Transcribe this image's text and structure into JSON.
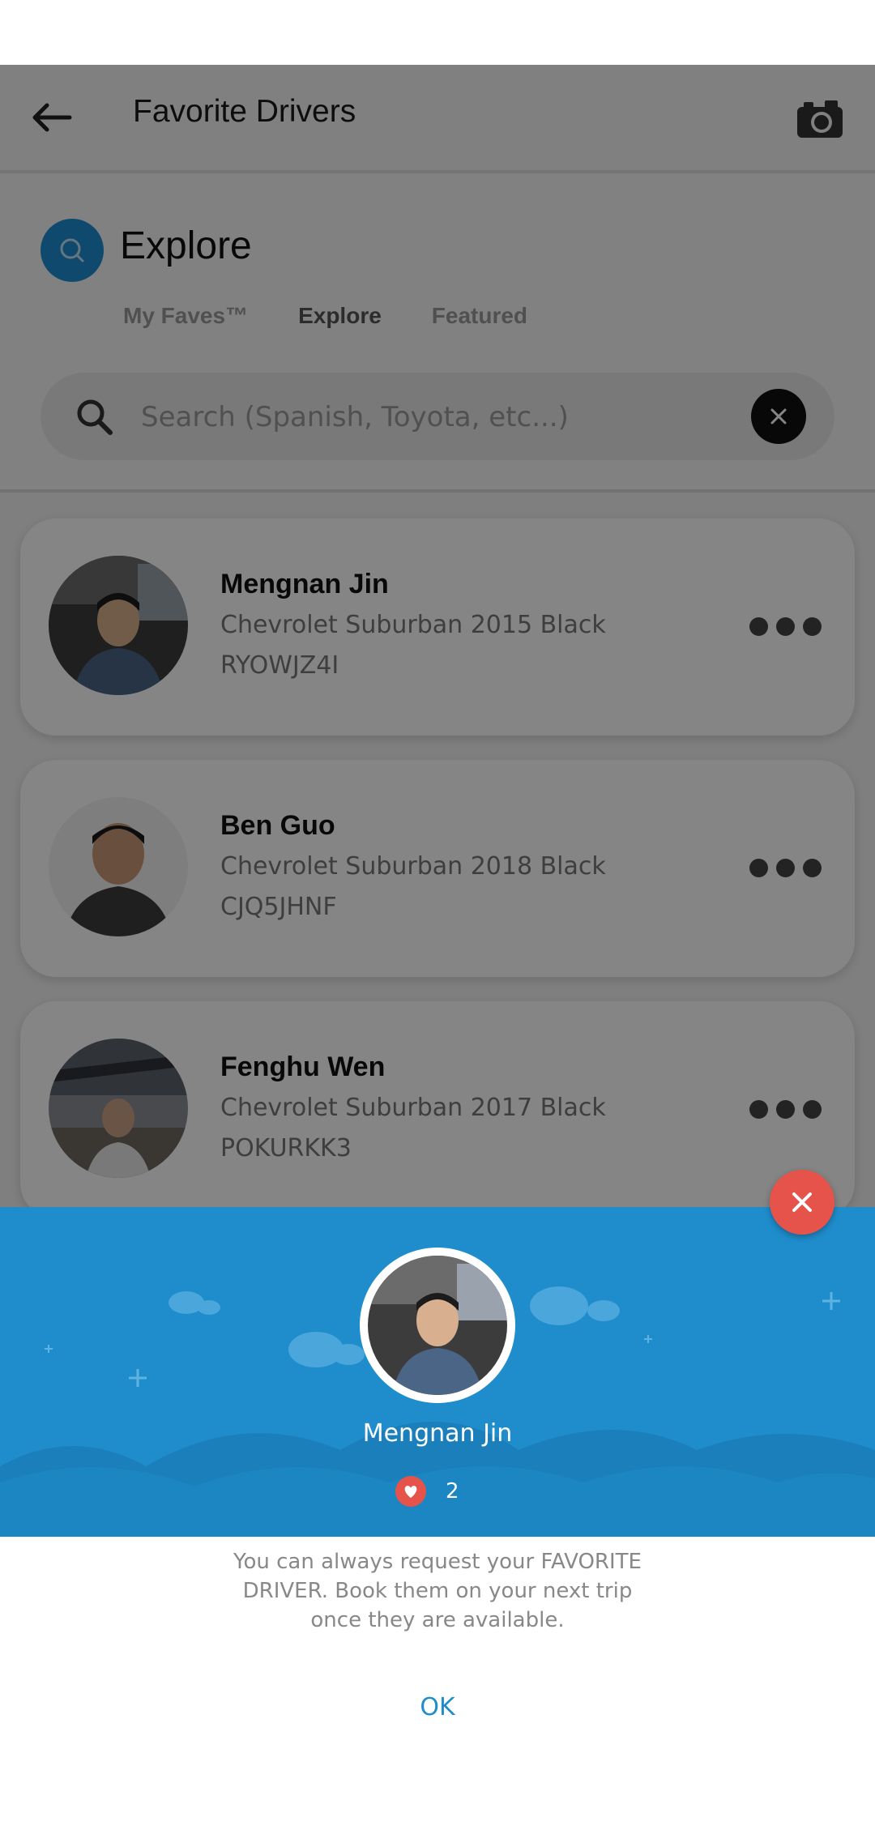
{
  "appbar": {
    "title": "Favorite Drivers"
  },
  "explore": {
    "title": "Explore",
    "tabs": [
      {
        "label": "My Faves™",
        "active": false
      },
      {
        "label": "Explore",
        "active": true
      },
      {
        "label": "Featured",
        "active": false
      }
    ],
    "search": {
      "placeholder": "Search (Spanish, Toyota, etc...)"
    }
  },
  "drivers": [
    {
      "name": "Mengnan Jin",
      "car": "Chevrolet Suburban 2015 Black",
      "plate": "RYOWJZ4I"
    },
    {
      "name": "Ben Guo",
      "car": "Chevrolet Suburban 2018 Black",
      "plate": "CJQ5JHNF"
    },
    {
      "name": "Fenghu Wen",
      "car": "Chevrolet Suburban 2017 Black",
      "plate": "POKURKK3"
    }
  ],
  "modal": {
    "name": "Mengnan Jin",
    "fav_count": "2",
    "message": "You can always request your FAVORITE DRIVER. Book them on your next trip once they are available.",
    "ok_label": "OK"
  },
  "colors": {
    "accent": "#1f8dcc",
    "danger": "#e6534b"
  },
  "icons": {
    "back": "arrow-left-icon",
    "camera": "camera-icon",
    "search": "search-icon",
    "clear": "close-icon",
    "more": "more-horizontal-icon",
    "heart": "heart-icon"
  }
}
